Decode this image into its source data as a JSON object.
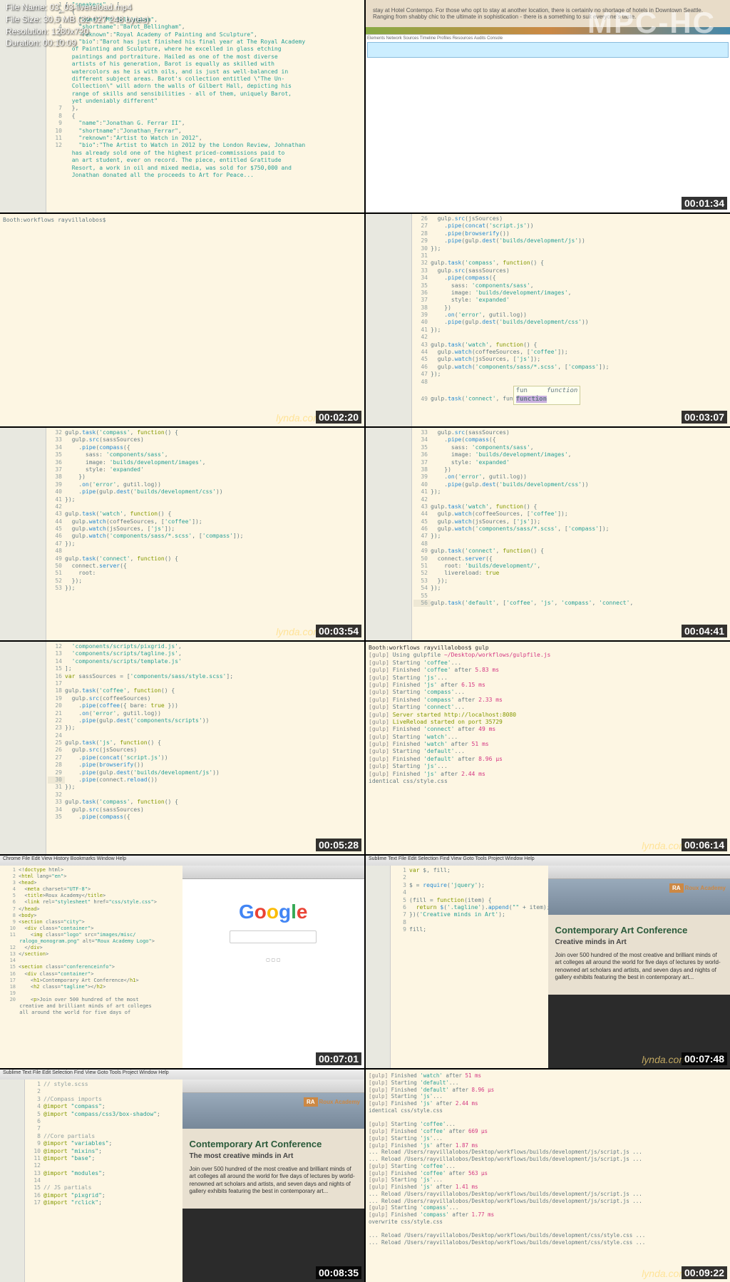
{
  "fileinfo": {
    "name_label": "File Name:",
    "name": "03_03-livereload.mp4",
    "size_label": "File Size:",
    "size": "30,5 MB (32 027 248 bytes)",
    "res_label": "Resolution:",
    "res": "1280x720",
    "dur_label": "Duration:",
    "dur": "00:10:09"
  },
  "watermark": "MPC-HC",
  "brand": "lynda.com",
  "timestamps": [
    "00:01:34",
    "00:02:20",
    "00:03:07",
    "00:03:54",
    "00:04:41",
    "00:05:28",
    "00:06:14",
    "00:07:01",
    "00:07:48",
    "00:08:35",
    "00:09:22"
  ],
  "thumb1": {
    "lines": [
      "{ \"speakers\" : [",
      "  {",
      "    \"name\":\"Mr Bellingham\",",
      "    \"shortname\":\"Barot_Bellingham\",",
      "    \"reknown\":\"Royal Academy of Painting and Sculpture\",",
      "    \"bio\":\"Barot has just finished his final year at The Royal Academy",
      "      of Painting and Sculpture, where he excelled in glass etching",
      "      paintings and portraiture. Hailed as one of the most diverse",
      "      artists of his generation, Barot is equally as skilled with",
      "      watercolors as he is with oils, and is just as well-balanced in",
      "      different subject areas. Barot's collection entitled \\\"The Un-",
      "      Collection\\\" will adorn the walls of Gilbert Hall, depicting his",
      "      range of skills and sensibilities - all of them, uniquely Barot,",
      "      yet undeniably different\"",
      "  },",
      "  {",
      "    \"name\":\"Jonathan G. Ferrar II\",",
      "    \"shortname\":\"Jonathan_Ferrar\",",
      "    \"reknown\":\"Artist to Watch in 2012\",",
      "    \"bio\":\"The Artist to Watch in 2012 by the London Review, Johnathan",
      "      has already sold one of the highest priced-commissions paid to",
      "      an art student, ever on record. The piece, entitled Gratitude",
      "      Resort, a work in oil and mixed media, was sold for $750,000 and",
      "      Jonathan donated all the proceeds to Art for Peace..."
    ]
  },
  "thumb2": {
    "text": "stay at Hotel Contempo. For those who opt to stay at another location, there is certainly no shortage of hotels in Downtown Seattle. Ranging from shabby chic to the ultimate in sophistication - there is a something to suit everyone's taste.",
    "devtools_tabs": "Elements Network Sources Timeline Profiles Resources Audits Console"
  },
  "thumb3": {
    "prompt": "Booth:workflows rayvillalobos$"
  },
  "thumb4": {
    "lines": [
      "26    gulp.src(jsSources)",
      "27      .pipe(concat('script.js'))",
      "28      .pipe(browserify())",
      "29      .pipe(gulp.dest('builds/development/js'))",
      "30  });",
      "31",
      "32  gulp.task('compass', function() {",
      "33    gulp.src(sassSources)",
      "34      .pipe(compass({",
      "35        sass: 'components/sass',",
      "36        image: 'builds/development/images',",
      "37        style: 'expanded'",
      "38      })",
      "39      .on('error', gutil.log))",
      "40      .pipe(gulp.dest('builds/development/css'))",
      "41  });",
      "42",
      "43  gulp.task('watch', function() {",
      "44    gulp.watch(coffeeSources, ['coffee']);",
      "45    gulp.watch(jsSources, ['js']);",
      "46    gulp.watch('components/sass/*.scss', ['compass']);",
      "47  });",
      "48",
      "49  gulp.task('connect', fun"
    ],
    "tooltip1": "fun",
    "tooltip2": "function",
    "tooltip_hint": "function"
  },
  "thumb5": {
    "lines": [
      "32  gulp.task('compass', function() {",
      "33    gulp.src(sassSources)",
      "34      .pipe(compass({",
      "35        sass: 'components/sass',",
      "36        image: 'builds/development/images',",
      "37        style: 'expanded'",
      "38      })",
      "39      .on('error', gutil.log))",
      "40      .pipe(gulp.dest('builds/development/css'))",
      "41  });",
      "42",
      "43  gulp.task('watch', function() {",
      "44    gulp.watch(coffeeSources, ['coffee']);",
      "45    gulp.watch(jsSources, ['js']);",
      "46    gulp.watch('components/sass/*.scss', ['compass']);",
      "47  });",
      "48",
      "49  gulp.task('connect', function() {",
      "50    connect.server({",
      "51      root:",
      "52    });",
      "53  });"
    ]
  },
  "thumb6": {
    "lines": [
      "33    gulp.src(sassSources)",
      "34      .pipe(compass({",
      "35        sass: 'components/sass',",
      "36        image: 'builds/development/images',",
      "37        style: 'expanded'",
      "38      })",
      "39      .on('error', gutil.log))",
      "40      .pipe(gulp.dest('builds/development/css'))",
      "41  });",
      "42",
      "43  gulp.task('watch', function() {",
      "44    gulp.watch(coffeeSources, ['coffee']);",
      "45    gulp.watch(jsSources, ['js']);",
      "46    gulp.watch('components/sass/*.scss', ['compass']);",
      "47  });",
      "48",
      "49  gulp.task('connect', function() {",
      "50    connect.server({",
      "51      root: 'builds/development/',",
      "52      livereload: true",
      "53    });",
      "54  });",
      "55",
      "56  gulp.task('default', ['coffee', 'js', 'compass', 'connect',"
    ]
  },
  "thumb7": {
    "lines": [
      "12    'components/scripts/pixgrid.js',",
      "13    'components/scripts/tagline.js',",
      "14    'components/scripts/template.js'",
      "15  ];",
      "16  var sassSources = ['components/sass/style.scss'];",
      "17",
      "18  gulp.task('coffee', function() {",
      "19    gulp.src(coffeeSources)",
      "20      .pipe(coffee({ bare: true }))",
      "21      .on('error', gutil.log))",
      "22      .pipe(gulp.dest('components/scripts'))",
      "23  });",
      "24",
      "25  gulp.task('js', function() {",
      "26    gulp.src(jsSources)",
      "27      .pipe(concat('script.js'))",
      "28      .pipe(browserify())",
      "29      .pipe(gulp.dest('builds/development/js'))",
      "30      .pipe(connect.reload())",
      "31  });",
      "32",
      "33  gulp.task('compass', function() {",
      "34    gulp.src(sassSources)",
      "35      .pipe(compass({"
    ]
  },
  "thumb8": {
    "prompt": "Booth:workflows rayvillalobos$ gulp",
    "lines": [
      "[gulp] Using gulpfile ~/Desktop/workflows/gulpfile.js",
      "[gulp] Starting 'coffee'...",
      "[gulp] Finished 'coffee' after 5.83 ms",
      "[gulp] Starting 'js'...",
      "[gulp] Finished 'js' after 6.15 ms",
      "[gulp] Starting 'compass'...",
      "[gulp] Finished 'compass' after 2.33 ms",
      "[gulp] Starting 'connect'...",
      "[gulp] Server started http://localhost:8080",
      "[gulp] LiveReload started on port 35729",
      "[gulp] Finished 'connect' after 49 ms",
      "[gulp] Starting 'watch'...",
      "[gulp] Finished 'watch' after 51 ms",
      "[gulp] Starting 'default'...",
      "[gulp] Finished 'default' after 8.96 μs",
      "[gulp] Starting 'js'...",
      "[gulp] Finished 'js' after 2.44 ms",
      "identical css/style.css"
    ]
  },
  "thumb9": {
    "menubar": "Chrome File Edit View History Bookmarks Window Help",
    "lines": [
      "1  <!doctype html>",
      "2  <html lang=\"en\">",
      "3  <head>",
      "4    <meta charset=\"UTF-8\">",
      "5    <title>Roux Academy</title>",
      "6    <link rel=\"stylesheet\" href=\"css/style.css\">",
      "7  </head>",
      "8  <body>",
      "9  <section class=\"city\">",
      "10   <div class=\"container\">",
      "11     <img class=\"logo\" src=\"images/misc/",
      "       ralogo_monogram.png\" alt=\"Roux Academy Logo\">",
      "12   </div>",
      "13 </section>",
      "14",
      "15 <section class=\"conferenceinfo\">",
      "16   <div class=\"container\">",
      "17     <h1>Contemporary Art Conference</h1>",
      "18     <h2 class=\"tagline\"></h2>",
      "19",
      "20     <p>Join over 500 hundred of the most",
      "       creative and brilliant minds of art colleges",
      "       all around the world for five days of"
    ],
    "google": "Google"
  },
  "thumb10": {
    "menubar": "Sublime Text File Edit Selection Find View Goto Tools Project Window Help",
    "lines": [
      "1  var $, fill;",
      "2",
      "3  $ = require('jquery');",
      "4",
      "5  (fill = function(item) {",
      "6    return $('.tagline').append(\"\" + item);",
      "7  })('Creative minds in Art');",
      "8",
      "9  fill;"
    ],
    "logo": "RA",
    "logo_text": "Roux Academy",
    "h1": "Contemporary Art Conference",
    "h2": "Creative minds in Art",
    "body": "Join over 500 hundred of the most creative and brilliant minds of art colleges all around the world for five days of lectures by world-renowned art scholars and artists, and seven days and nights of gallery exhibits featuring the best in contemporary art..."
  },
  "thumb11": {
    "menubar": "Sublime Text File Edit Selection Find View Goto Tools Project Window Help",
    "file": "style.scss",
    "lines": [
      "1  // style.scss",
      "2",
      "3  //Compass imports",
      "4  @import \"compass\";",
      "5  @import \"compass/css3/box-shadow\";",
      "6",
      "7",
      "8  //Core partials",
      "9  @import \"variables\";",
      "10 @import \"mixins\";",
      "11 @import \"base\";",
      "12",
      "13 @import \"modules\";",
      "14",
      "15 // JS partials",
      "16 @import \"pixgrid\";",
      "17 @import \"rclick\";"
    ],
    "logo": "RA",
    "logo_text": "Roux Academy",
    "h1": "Contemporary Art Conference",
    "h2": "The most creative minds in Art",
    "body": "Join over 500 hundred of the most creative and brilliant minds of art colleges all around the world for five days of lectures by world-renowned art scholars and artists, and seven days and nights of gallery exhibits featuring the best in contemporary art..."
  },
  "thumb12": {
    "lines": [
      "[gulp] Finished 'watch' after 51 ms",
      "[gulp] Starting 'default'...",
      "[gulp] Finished 'default' after 8.96 μs",
      "[gulp] Starting 'js'...",
      "[gulp] Finished 'js' after 2.44 ms",
      "identical css/style.css",
      "",
      "[gulp] Starting 'coffee'...",
      "[gulp] Finished 'coffee' after 669 μs",
      "[gulp] Starting 'js'...",
      "[gulp] Finished 'js' after 1.87 ms",
      "... Reload /Users/rayvillalobos/Desktop/workflows/builds/development/js/script.js ...",
      "... Reload /Users/rayvillalobos/Desktop/workflows/builds/development/js/script.js ...",
      "[gulp] Starting 'coffee'...",
      "[gulp] Finished 'coffee' after 563 μs",
      "[gulp] Starting 'js'...",
      "[gulp] Finished 'js' after 1.41 ms",
      "... Reload /Users/rayvillalobos/Desktop/workflows/builds/development/js/script.js ...",
      "... Reload /Users/rayvillalobos/Desktop/workflows/builds/development/js/script.js ...",
      "[gulp] Starting 'compass'...",
      "[gulp] Finished 'compass' after 1.77 ms",
      "overwrite css/style.css",
      "",
      "... Reload /Users/rayvillalobos/Desktop/workflows/builds/development/css/style.css ...",
      "... Reload /Users/rayvillalobos/Desktop/workflows/builds/development/css/style.css ..."
    ]
  }
}
